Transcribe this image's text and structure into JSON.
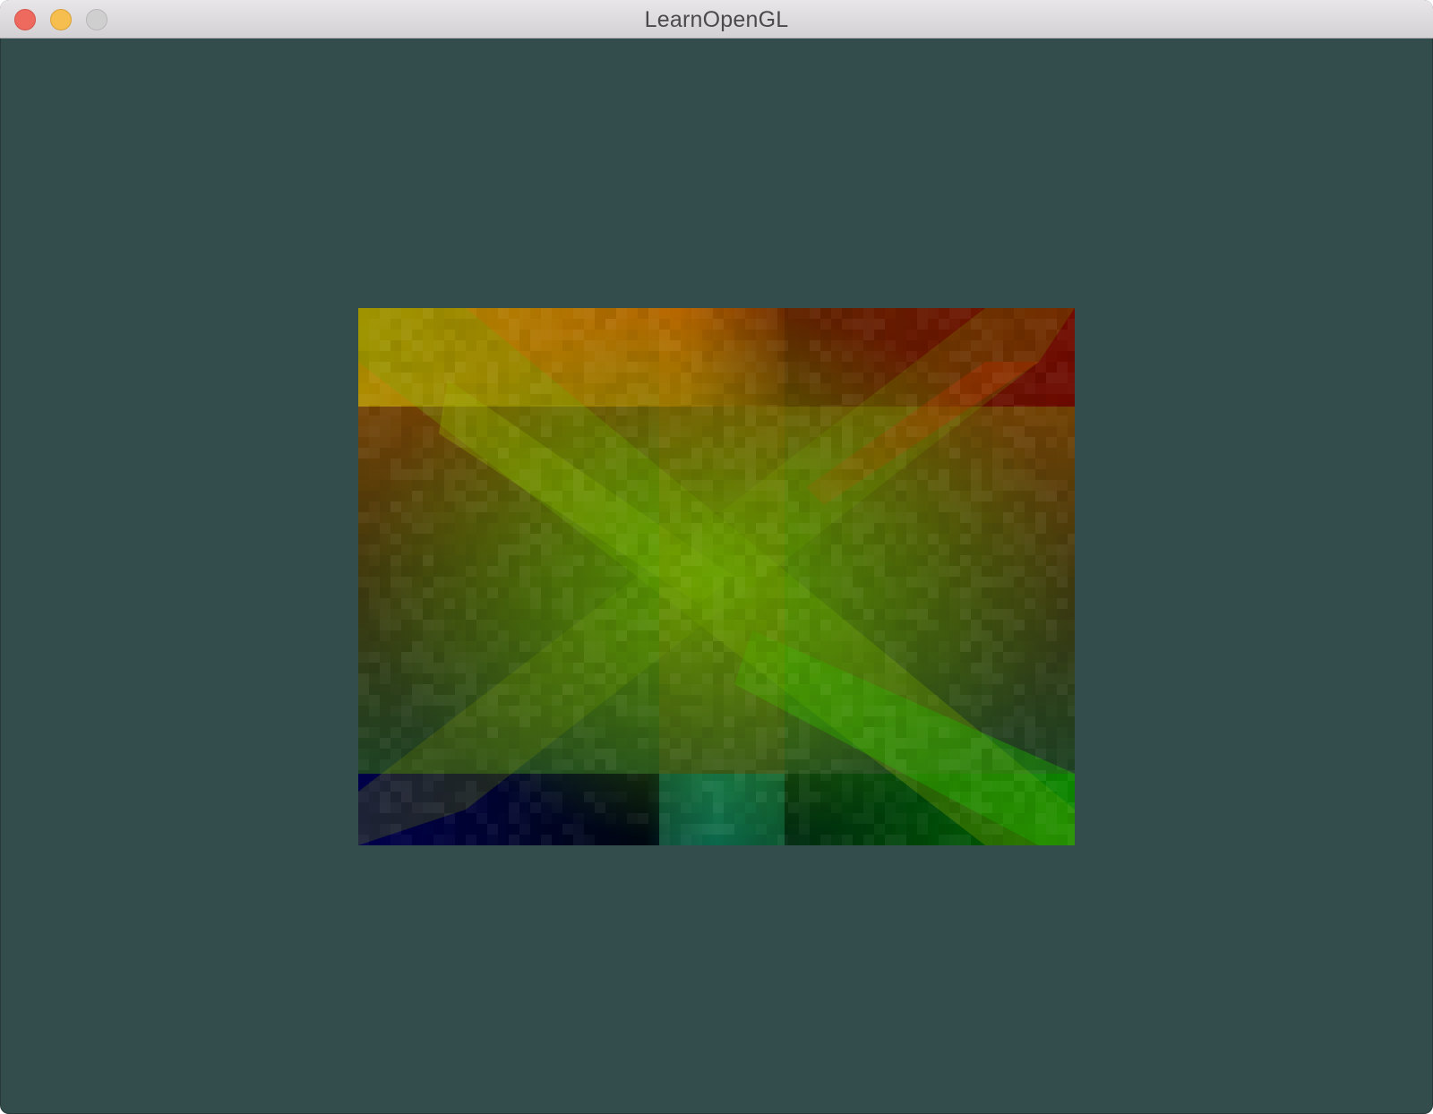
{
  "window": {
    "title": "LearnOpenGL",
    "clear_color": "#334d4d"
  },
  "titlebar": {
    "buttons": [
      {
        "name": "close",
        "color": "#ee6a5f"
      },
      {
        "name": "minimize",
        "color": "#f5be4f"
      },
      {
        "name": "zoom",
        "color": "#d0cfd0"
      }
    ]
  },
  "rendered_quad": {
    "corner_colors": {
      "top_left": "#b89a00",
      "top_right": "#6b0000",
      "bottom_left": "#00004d",
      "bottom_right": "#006b00"
    }
  }
}
